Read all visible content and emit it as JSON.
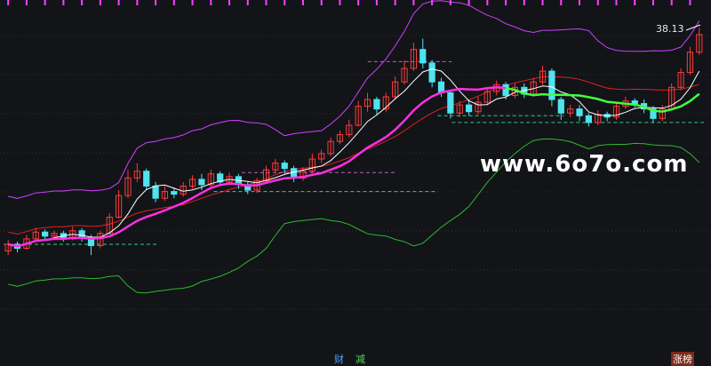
{
  "chart_data": {
    "type": "candlestick",
    "title": "",
    "last_price_label": "38.13",
    "watermark": "www.6o7o.com",
    "bottom_tags": [
      "财",
      "减",
      "涨榜"
    ],
    "colors": {
      "background": "#121418",
      "up_candle": "#ff3b3b",
      "down_candle": "#4fe3f0",
      "upper_band": "#d040ff",
      "mid_band": "#e02020",
      "lower_band": "#2fb82f",
      "ma_fast": "#ffffff",
      "ma_slow": "#ff30e0",
      "ma_slow_recent": "#40ff40",
      "dashed_support": "#30d080",
      "dashed_resistance": "#c060c0",
      "top_dots": "#ff40ff"
    },
    "y_range": [
      18,
      40
    ],
    "candles": [
      [
        22.1,
        22.6,
        22.9,
        21.8
      ],
      [
        22.6,
        22.3,
        22.8,
        22.0
      ],
      [
        22.3,
        23.0,
        23.3,
        22.2
      ],
      [
        23.0,
        23.5,
        23.8,
        22.9
      ],
      [
        23.5,
        23.2,
        23.7,
        22.9
      ],
      [
        23.2,
        23.4,
        23.6,
        23.0
      ],
      [
        23.4,
        23.0,
        23.6,
        22.8
      ],
      [
        23.0,
        23.6,
        23.9,
        22.9
      ],
      [
        23.6,
        23.1,
        23.8,
        22.8
      ],
      [
        23.1,
        22.5,
        23.3,
        21.8
      ],
      [
        22.5,
        23.4,
        23.6,
        22.3
      ],
      [
        23.4,
        24.6,
        24.9,
        23.3
      ],
      [
        24.6,
        26.2,
        26.6,
        24.5
      ],
      [
        26.2,
        27.5,
        28.1,
        26.0
      ],
      [
        27.5,
        28.0,
        28.6,
        27.2
      ],
      [
        28.0,
        26.9,
        28.2,
        26.6
      ],
      [
        26.9,
        26.0,
        27.2,
        25.7
      ],
      [
        26.0,
        26.5,
        26.9,
        25.8
      ],
      [
        26.5,
        26.3,
        26.8,
        26.0
      ],
      [
        26.3,
        26.9,
        27.2,
        26.1
      ],
      [
        26.9,
        27.4,
        27.7,
        26.7
      ],
      [
        27.4,
        27.0,
        27.8,
        26.6
      ],
      [
        27.0,
        27.8,
        28.1,
        26.8
      ],
      [
        27.8,
        27.2,
        28.0,
        26.9
      ],
      [
        27.2,
        27.6,
        27.9,
        27.0
      ],
      [
        27.6,
        27.0,
        27.8,
        26.7
      ],
      [
        27.0,
        26.6,
        27.2,
        26.3
      ],
      [
        26.6,
        27.3,
        27.5,
        26.4
      ],
      [
        27.3,
        28.1,
        28.4,
        27.1
      ],
      [
        28.1,
        28.6,
        28.9,
        27.9
      ],
      [
        28.6,
        28.2,
        28.8,
        27.8
      ],
      [
        28.2,
        27.5,
        28.4,
        27.2
      ],
      [
        27.5,
        28.0,
        28.3,
        27.3
      ],
      [
        28.0,
        28.9,
        29.3,
        27.9
      ],
      [
        28.9,
        29.3,
        29.6,
        28.6
      ],
      [
        29.3,
        30.2,
        30.5,
        29.1
      ],
      [
        30.2,
        30.7,
        31.0,
        30.0
      ],
      [
        30.7,
        31.4,
        31.8,
        30.5
      ],
      [
        31.4,
        32.8,
        33.2,
        31.3
      ],
      [
        32.8,
        33.3,
        33.8,
        32.4
      ],
      [
        33.3,
        32.6,
        33.5,
        32.2
      ],
      [
        32.6,
        33.5,
        33.8,
        32.4
      ],
      [
        33.5,
        34.6,
        35.0,
        33.3
      ],
      [
        34.6,
        35.6,
        36.2,
        34.4
      ],
      [
        35.6,
        37.0,
        37.5,
        35.4
      ],
      [
        37.0,
        36.0,
        37.8,
        35.6
      ],
      [
        36.0,
        34.6,
        36.2,
        34.2
      ],
      [
        34.6,
        33.8,
        34.9,
        33.5
      ],
      [
        33.8,
        32.3,
        34.0,
        31.9
      ],
      [
        32.3,
        32.9,
        33.2,
        32.0
      ],
      [
        32.9,
        32.4,
        33.3,
        32.1
      ],
      [
        32.4,
        33.1,
        33.5,
        32.2
      ],
      [
        33.1,
        33.9,
        34.2,
        32.9
      ],
      [
        33.9,
        34.4,
        34.7,
        33.6
      ],
      [
        34.4,
        33.6,
        34.6,
        33.3
      ],
      [
        33.6,
        34.2,
        34.5,
        33.4
      ],
      [
        34.2,
        33.7,
        34.5,
        33.4
      ],
      [
        33.7,
        34.6,
        34.9,
        33.5
      ],
      [
        34.6,
        35.4,
        35.8,
        34.4
      ],
      [
        35.4,
        33.3,
        35.6,
        32.8
      ],
      [
        33.3,
        32.3,
        33.5,
        31.8
      ],
      [
        32.3,
        32.6,
        32.9,
        32.0
      ],
      [
        32.6,
        32.1,
        32.9,
        31.7
      ],
      [
        32.1,
        31.6,
        32.3,
        31.3
      ],
      [
        31.6,
        32.2,
        32.5,
        31.4
      ],
      [
        32.2,
        32.0,
        32.4,
        31.7
      ],
      [
        32.0,
        32.8,
        33.1,
        31.8
      ],
      [
        32.8,
        33.2,
        33.5,
        32.6
      ],
      [
        33.2,
        33.0,
        33.4,
        32.7
      ],
      [
        33.0,
        32.6,
        33.3,
        32.3
      ],
      [
        32.6,
        31.9,
        32.8,
        31.6
      ],
      [
        31.9,
        32.6,
        32.9,
        31.7
      ],
      [
        32.6,
        34.2,
        34.5,
        32.5
      ],
      [
        34.2,
        35.3,
        35.6,
        34.0
      ],
      [
        35.3,
        36.8,
        37.2,
        35.1
      ],
      [
        36.8,
        38.1,
        38.6,
        36.6
      ]
    ],
    "series_names": [],
    "dashed_levels": [
      {
        "y": 22.6,
        "color_key": "dashed_support"
      },
      {
        "y": 26.5,
        "color_key": "dashed_support"
      },
      {
        "y": 32.1,
        "color_key": "dashed_support"
      },
      {
        "y": 31.6,
        "color_key": "dashed_support"
      },
      {
        "y": 27.9,
        "color_key": "dashed_resistance"
      },
      {
        "y": 36.1,
        "color_key": "dashed_resistance"
      }
    ]
  }
}
